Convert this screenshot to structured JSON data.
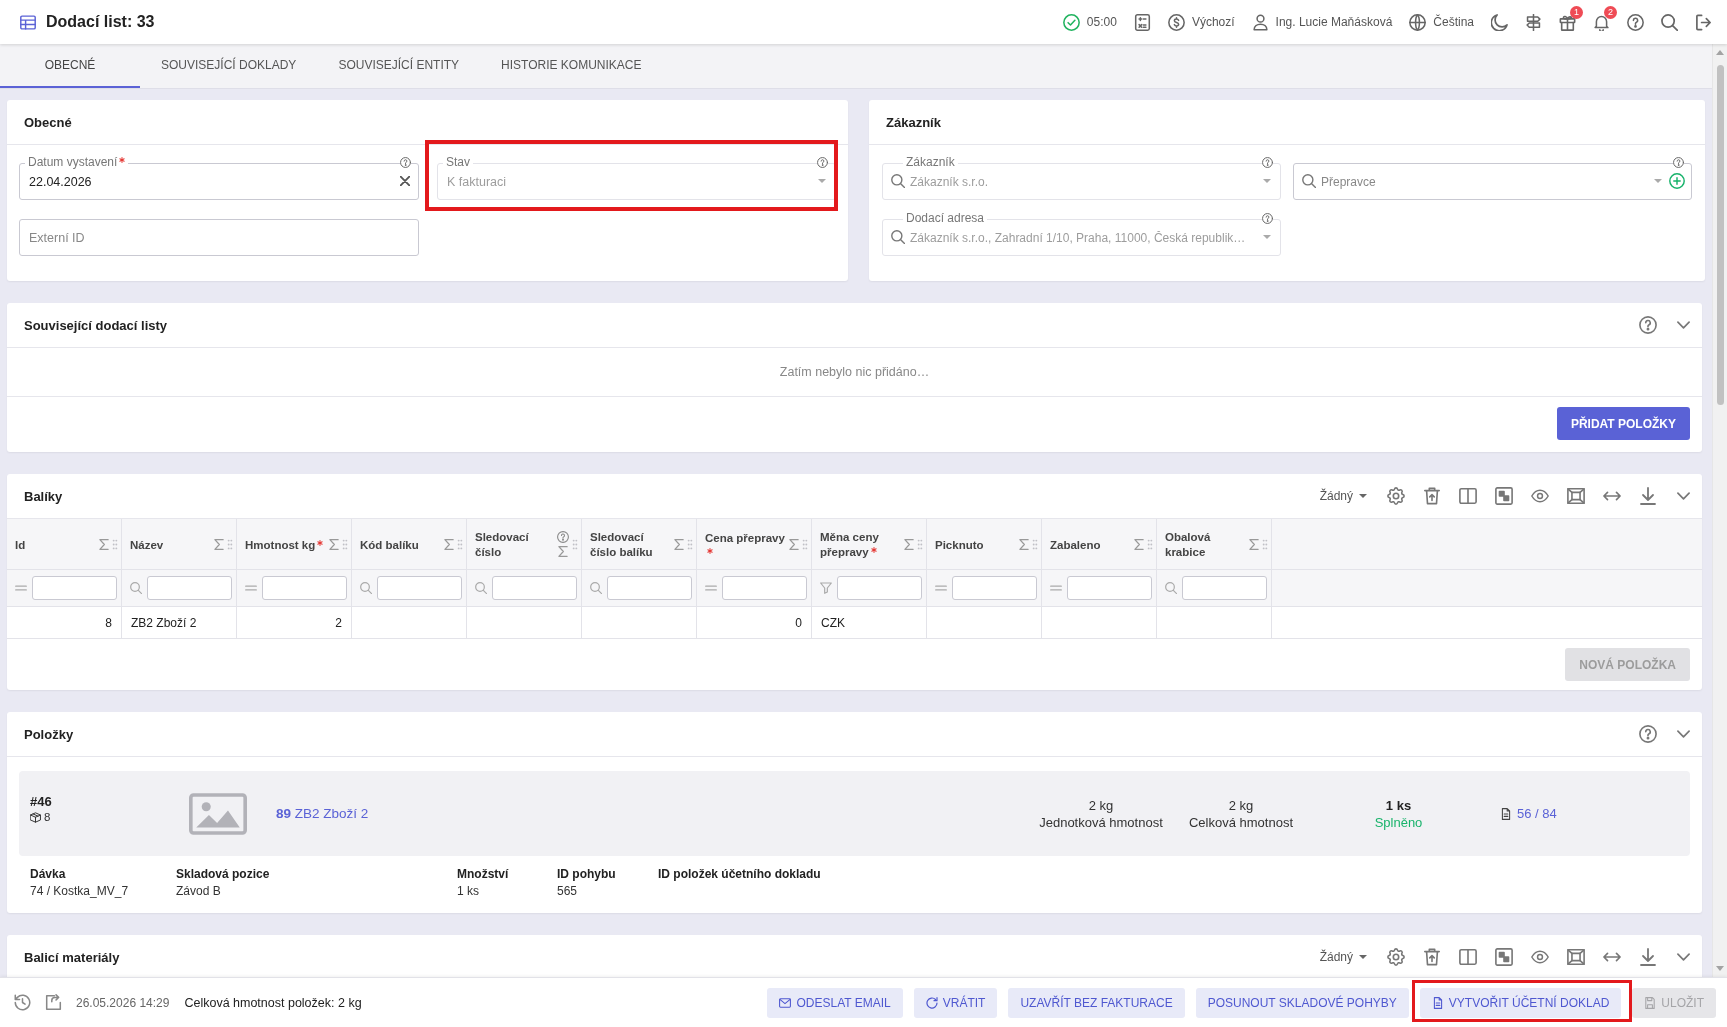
{
  "header": {
    "title": "Dodací list: 33",
    "actions": [
      {
        "kind": "sync",
        "label": "05:00"
      },
      {
        "kind": "calculator"
      },
      {
        "kind": "currency",
        "label": "Výchozí"
      },
      {
        "kind": "user",
        "label": "Ing. Lucie Maňásková"
      },
      {
        "kind": "language",
        "label": "Čeština"
      },
      {
        "kind": "theme"
      },
      {
        "kind": "signpost"
      },
      {
        "kind": "gift",
        "badge": "1"
      },
      {
        "kind": "notifications",
        "badge": "2"
      },
      {
        "kind": "help"
      },
      {
        "kind": "search"
      },
      {
        "kind": "logout"
      }
    ]
  },
  "tabs": [
    {
      "label": "OBECNÉ",
      "selected": true
    },
    {
      "label": "SOUVISEJÍCÍ DOKLADY",
      "selected": false
    },
    {
      "label": "SOUVISEJÍCÍ ENTITY",
      "selected": false
    },
    {
      "label": "HISTORIE KOMUNIKACE",
      "selected": false
    }
  ],
  "general": {
    "title": "Obecné",
    "fields": [
      {
        "kind": "date",
        "label": "Datum vystavení",
        "value": "22.04.2026",
        "required": true,
        "disabled": false,
        "help": true,
        "highlighted": false
      },
      {
        "kind": "select",
        "label": "Stav",
        "value": "K fakturaci",
        "required": false,
        "disabled": true,
        "help": true,
        "highlighted": true
      },
      {
        "kind": "text",
        "placeholder": "Externí ID",
        "required": false,
        "disabled": false,
        "help": false,
        "highlighted": false
      }
    ]
  },
  "customer": {
    "title": "Zákazník",
    "fields": [
      {
        "kind": "lookup",
        "label": "Zákazník",
        "value": "Zákazník s.r.o.",
        "required": false,
        "disabled": true,
        "help": true,
        "addable": false,
        "highlighted": false
      },
      {
        "kind": "lookup",
        "placeholder": "Přepravce",
        "required": false,
        "disabled": false,
        "help": true,
        "addable": true,
        "highlighted": false
      },
      {
        "kind": "lookup",
        "label": "Dodací adresa",
        "value": "Zákazník s.r.o., Zahradní 1/10, Praha, 11000, Česká republik…",
        "required": false,
        "disabled": true,
        "help": true,
        "addable": false,
        "highlighted": false
      }
    ]
  },
  "related": {
    "title": "Související dodací listy",
    "empty_text": "Zatím nebylo nic přidáno…",
    "button": "PŘIDAT POLOŽKY"
  },
  "packages": {
    "title": "Balíky",
    "view": "Žádný",
    "columns": [
      {
        "title": "Id",
        "kind": "number",
        "required": false,
        "help": false
      },
      {
        "title": "Název",
        "kind": "text",
        "required": false,
        "help": false
      },
      {
        "title": "Hmotnost kg",
        "kind": "number",
        "required": true,
        "help": false
      },
      {
        "title": "Kód balíku",
        "kind": "text",
        "required": false,
        "help": false
      },
      {
        "title": "Sledovací číslo",
        "kind": "text",
        "required": false,
        "help": true
      },
      {
        "title": "Sledovací číslo balíku",
        "kind": "text",
        "required": false,
        "help": false
      },
      {
        "title": "Cena přepravy",
        "kind": "number",
        "required": true,
        "help": false
      },
      {
        "title": "Měna ceny přepravy",
        "kind": "text",
        "required": true,
        "help": false
      },
      {
        "title": "Picknuto",
        "kind": "text",
        "required": false,
        "help": false
      },
      {
        "title": "Zabaleno",
        "kind": "text",
        "required": false,
        "help": false
      },
      {
        "title": "Obalová krabice",
        "kind": "text",
        "required": false,
        "help": false
      }
    ],
    "filters": [
      {
        "kind": "equals"
      },
      {
        "kind": "search"
      },
      {
        "kind": "equals"
      },
      {
        "kind": "search"
      },
      {
        "kind": "search"
      },
      {
        "kind": "search"
      },
      {
        "kind": "equals"
      },
      {
        "kind": "funnel"
      },
      {
        "kind": "equals"
      },
      {
        "kind": "equals"
      },
      {
        "kind": "search"
      }
    ],
    "rows": [
      [
        "8",
        "ZB2 Zboží 2",
        "2",
        null,
        null,
        null,
        "0",
        "CZK",
        null,
        null,
        null
      ]
    ],
    "button": {
      "label": "NOVÁ POLOŽKA",
      "disabled": true
    }
  },
  "items": {
    "title": "Položky",
    "entries": [
      {
        "number": "#46",
        "package_count": "8",
        "product": "**89** ZB2 Zboží 2",
        "unit_weight": "2 kg",
        "unit_weight_label": "Jednotková hmotnost",
        "total_weight": "2 kg",
        "total_weight_label": "Celková hmotnost",
        "quantity": "1 ks",
        "status": "Splněno",
        "documents": "56 / 84",
        "details": [
          {
            "label": "Dávka",
            "value": "74 / Kostka_MV_7"
          },
          {
            "label": "Skladová pozice",
            "value": "Závod B"
          },
          {
            "label": "Množství",
            "value": "1 ks"
          },
          {
            "label": "ID pohybu",
            "value": "565"
          },
          {
            "label": "ID položek účetního dokladu"
          }
        ]
      }
    ]
  },
  "packing_materials": {
    "title": "Balicí materiály",
    "view": "Žádný"
  },
  "footer": {
    "timestamp": "26.05.2026 14:29",
    "total_weight": "Celková hmotnost položek: 2 kg",
    "buttons": [
      {
        "kind": "email",
        "label": "ODESLAT EMAIL",
        "disabled": false,
        "highlighted": false
      },
      {
        "kind": "undo",
        "label": "VRÁTIT",
        "disabled": false,
        "highlighted": false
      },
      {
        "kind": "close",
        "label": "UZAVŘÍT BEZ FAKTURACE",
        "disabled": false,
        "highlighted": false
      },
      {
        "kind": "move",
        "label": "POSUNOUT SKLADOVÉ POHYBY",
        "disabled": false,
        "highlighted": false
      },
      {
        "kind": "document",
        "label": "VYTVOŘIT ÚČETNÍ DOKLAD",
        "disabled": false,
        "highlighted": true
      },
      {
        "kind": "save",
        "label": "ULOŽIT",
        "disabled": true,
        "highlighted": false
      }
    ]
  }
}
